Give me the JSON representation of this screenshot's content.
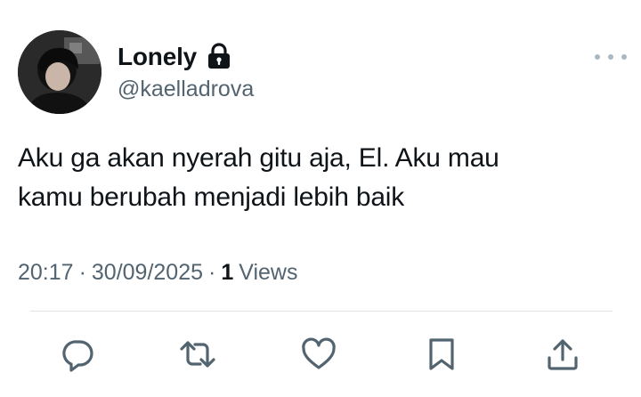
{
  "user": {
    "display_name": "Lonely",
    "handle": "@kaelladrova",
    "protected_icon": "lock-icon",
    "avatar_icon": "profile-photo"
  },
  "tweet": {
    "text": "Aku ga akan nyerah gitu aja, El. Aku mau\nkamu berubah menjadi lebih baik"
  },
  "meta": {
    "time": "20:17",
    "separator1": "·",
    "date": "30/09/2025",
    "separator2": "·",
    "views_count": "1",
    "views_label": "Views"
  },
  "actions": [
    {
      "name": "reply",
      "icon": "reply-icon"
    },
    {
      "name": "retweet",
      "icon": "retweet-icon"
    },
    {
      "name": "like",
      "icon": "heart-icon"
    },
    {
      "name": "bookmark",
      "icon": "bookmark-icon"
    },
    {
      "name": "share",
      "icon": "share-icon"
    }
  ],
  "colors": {
    "text_primary": "#0f1419",
    "text_secondary": "#536471",
    "divider": "#dfe4e8",
    "background": "#ffffff"
  }
}
